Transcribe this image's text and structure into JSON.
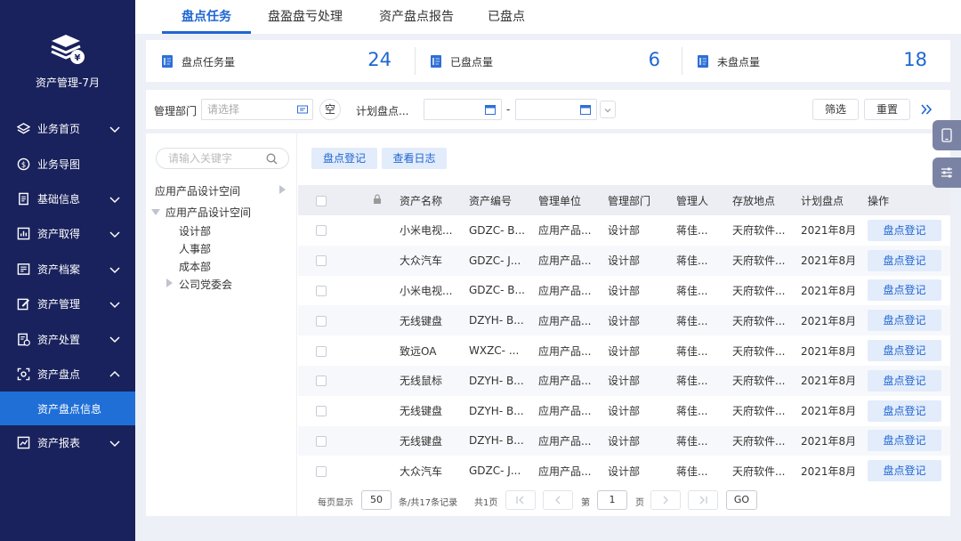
{
  "sidebar": {
    "app_title": "资产管理-7月",
    "items": [
      {
        "label": "业务首页",
        "icon": "layers-icon",
        "expandable": true
      },
      {
        "label": "业务导图",
        "icon": "dollar-icon",
        "expandable": false
      },
      {
        "label": "基础信息",
        "icon": "document-icon",
        "expandable": true
      },
      {
        "label": "资产取得",
        "icon": "bar-chart-icon",
        "expandable": true
      },
      {
        "label": "资产档案",
        "icon": "archive-icon",
        "expandable": true
      },
      {
        "label": "资产管理",
        "icon": "edit-icon",
        "expandable": true
      },
      {
        "label": "资产处置",
        "icon": "dispose-icon",
        "expandable": true
      },
      {
        "label": "资产盘点",
        "icon": "scan-icon",
        "expandable": true,
        "expanded": true
      },
      {
        "label": "资产盘点信息",
        "sub": true,
        "active": true
      },
      {
        "label": "资产报表",
        "icon": "report-icon",
        "expandable": true
      }
    ]
  },
  "tabs": [
    {
      "label": "盘点任务",
      "active": true
    },
    {
      "label": "盘盈盘亏处理"
    },
    {
      "label": "资产盘点报告"
    },
    {
      "label": "已盘点"
    }
  ],
  "stats": [
    {
      "label": "盘点任务量",
      "value": "24"
    },
    {
      "label": "已盘点量",
      "value": "6"
    },
    {
      "label": "未盘点量",
      "value": "18"
    }
  ],
  "filter": {
    "dept_label": "管理部门",
    "dept_placeholder": "请选择",
    "clear_label": "空",
    "plan_label": "计划盘点...",
    "range_sep": "-",
    "filter_btn": "筛选",
    "reset_btn": "重置"
  },
  "tree": {
    "search_placeholder": "请输入关键字",
    "nodes": [
      {
        "label": "应用产品设计空间",
        "level": 0,
        "arrow": "right-end"
      },
      {
        "label": "应用产品设计空间",
        "level": 0,
        "arrow": "down"
      },
      {
        "label": "设计部",
        "level": 1
      },
      {
        "label": "人事部",
        "level": 1
      },
      {
        "label": "成本部",
        "level": 1
      },
      {
        "label": "公司党委会",
        "level": 1,
        "arrow": "right"
      }
    ]
  },
  "actions": {
    "register": "盘点登记",
    "log": "查看日志"
  },
  "table": {
    "headers": [
      "资产名称",
      "资产编号",
      "管理单位",
      "管理部门",
      "管理人",
      "存放地点",
      "计划盘点",
      "操作"
    ],
    "action_label": "盘点登记",
    "rows": [
      [
        "小米电视...",
        "GDZC- B...",
        "应用产品...",
        "设计部",
        "蒋佳...",
        "天府软件...",
        "2021年8月"
      ],
      [
        "大众汽车",
        "GDZC- J...",
        "应用产品...",
        "设计部",
        "蒋佳...",
        "天府软件...",
        "2021年8月"
      ],
      [
        "小米电视...",
        "GDZC- B...",
        "应用产品...",
        "设计部",
        "蒋佳...",
        "天府软件...",
        "2021年8月"
      ],
      [
        "无线键盘",
        "DZYH- B...",
        "应用产品...",
        "设计部",
        "蒋佳...",
        "天府软件...",
        "2021年8月"
      ],
      [
        "致远OA",
        "WXZC- ...",
        "应用产品...",
        "设计部",
        "蒋佳...",
        "天府软件...",
        "2021年8月"
      ],
      [
        "无线鼠标",
        "DZYH- B...",
        "应用产品...",
        "设计部",
        "蒋佳...",
        "天府软件...",
        "2021年8月"
      ],
      [
        "无线键盘",
        "DZYH- B...",
        "应用产品...",
        "设计部",
        "蒋佳...",
        "天府软件...",
        "2021年8月"
      ],
      [
        "无线键盘",
        "DZYH- B...",
        "应用产品...",
        "设计部",
        "蒋佳...",
        "天府软件...",
        "2021年8月"
      ],
      [
        "大众汽车",
        "GDZC- J...",
        "应用产品...",
        "设计部",
        "蒋佳...",
        "天府软件...",
        "2021年8月"
      ]
    ]
  },
  "pager": {
    "per_page_label": "每页显示",
    "per_page": "50",
    "total_text": "条/共17条记录",
    "pages_text": "共1页",
    "page_prefix": "第",
    "page": "1",
    "page_suffix": "页",
    "go": "GO"
  },
  "colors": {
    "sidebar": "#19225c",
    "accent": "#1e66d2",
    "active_item": "#1f6fd6"
  }
}
